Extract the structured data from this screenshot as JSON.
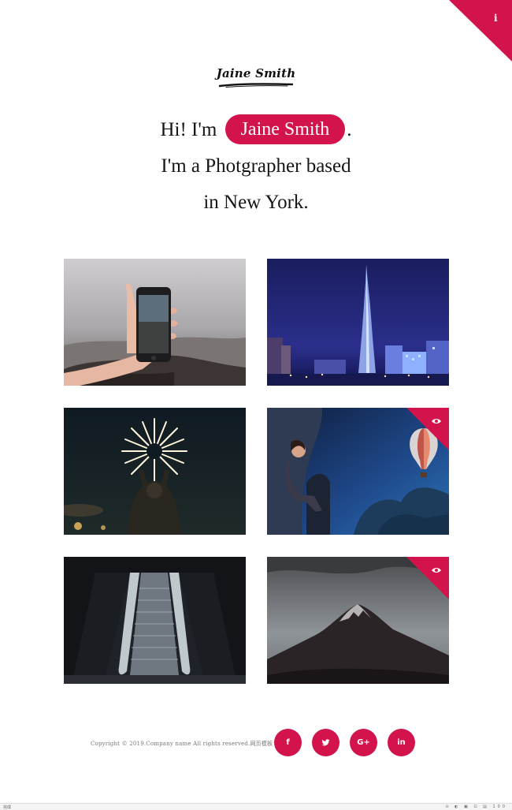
{
  "corner": {
    "icon": "info-icon",
    "glyph": "i",
    "color": "#d3134c"
  },
  "logo": {
    "text": "Jaine Smith"
  },
  "hero": {
    "greeting_prefix": "Hi! I'm",
    "name": "Jaine Smith",
    "greeting_suffix": ".",
    "line2": "I'm a Photgrapher based",
    "line3": "in New York."
  },
  "gallery": {
    "items": [
      {
        "subject": "hand holding phone at sea coast",
        "overlay": false
      },
      {
        "subject": "city skyscraper at night",
        "overlay": false
      },
      {
        "subject": "fireworks at night",
        "overlay": false
      },
      {
        "subject": "woman watching hot air balloon",
        "overlay": true,
        "overlay_icon": "eye-icon"
      },
      {
        "subject": "escalator in dark station",
        "overlay": false
      },
      {
        "subject": "mountain peak under clouds",
        "overlay": true,
        "overlay_icon": "eye-icon"
      }
    ]
  },
  "footer": {
    "copyright": "Copyright © 2019.Company name All rights reserved.网页模板",
    "socials": [
      {
        "icon": "facebook-icon",
        "label": "f"
      },
      {
        "icon": "twitter-icon",
        "label": ""
      },
      {
        "icon": "google-plus-icon",
        "label": "G+"
      },
      {
        "icon": "linkedin-icon",
        "label": "in"
      }
    ]
  },
  "statusbar": {
    "left": "完成",
    "right": "⊙ ◐ ▣ ⊡ ▤ 100"
  },
  "colors": {
    "accent": "#d3134c",
    "text": "#161616",
    "background": "#ffffff"
  }
}
